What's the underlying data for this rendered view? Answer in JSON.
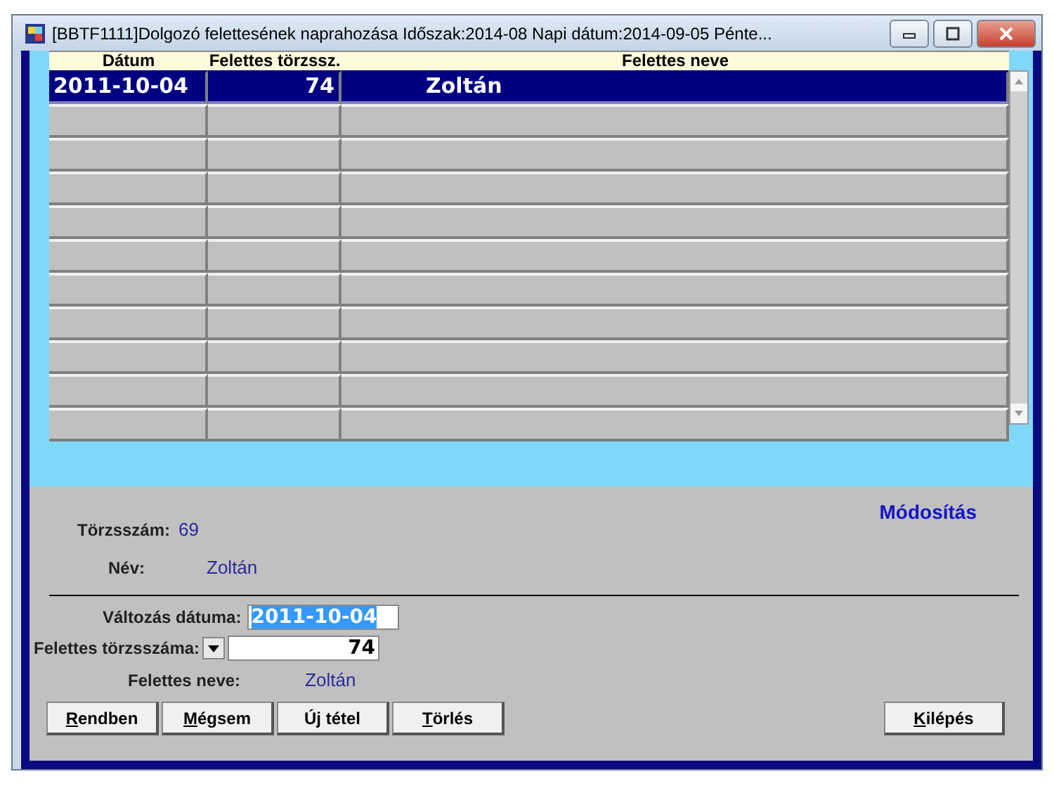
{
  "window": {
    "title": "[BBTF1111]Dolgozó felettesének naprahozása Időszak:2014-08 Napi dátum:2014-09-05 Pénte..."
  },
  "table": {
    "columns": [
      "Dátum",
      "Felettes törzssz.",
      "Felettes neve"
    ],
    "rows": [
      {
        "cells": [
          "2011-10-04",
          "74",
          "Zoltán"
        ],
        "selected": true
      }
    ]
  },
  "employee": {
    "id_label": "Törzsszám:",
    "id_value": "69",
    "name_label": "Név:",
    "name_value": "Zoltán",
    "mode": "Módosítás"
  },
  "form": {
    "date_label": "Változás dátuma:",
    "date_value": "2011-10-04",
    "boss_id_label": "Felettes törzsszáma:",
    "boss_id_value": "74",
    "boss_name_label": "Felettes neve:",
    "boss_name_value": "Zoltán"
  },
  "buttons": [
    {
      "key": "R",
      "rest": "endben"
    },
    {
      "key": "M",
      "rest": "égsem"
    },
    {
      "rest": "Új tétel"
    },
    {
      "key": "T",
      "rest": "örlés"
    }
  ],
  "exit_button": {
    "key": "K",
    "rest": "ilépés"
  }
}
